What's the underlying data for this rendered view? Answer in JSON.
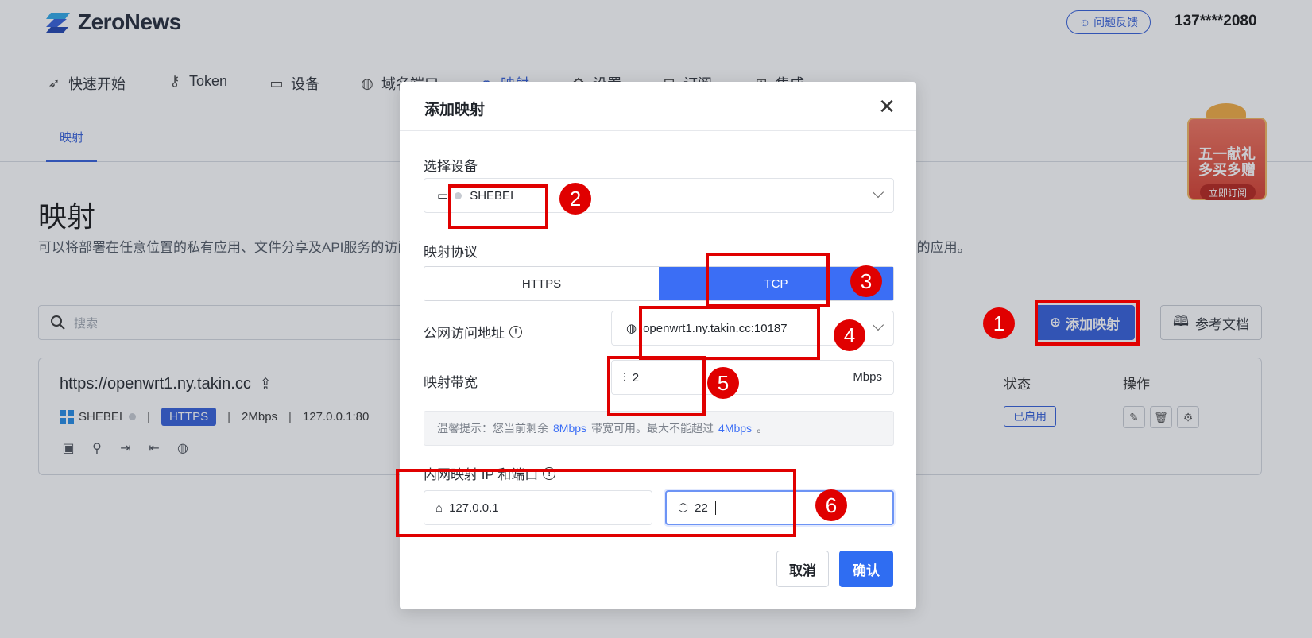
{
  "app": {
    "logo_text": "ZeroNews",
    "feedback_label": "问题反馈",
    "user_phone": "137****2080"
  },
  "nav": [
    {
      "label": "快速开始",
      "icon": "rocket-icon"
    },
    {
      "label": "Token",
      "icon": "key-icon"
    },
    {
      "label": "设备",
      "icon": "laptop-icon"
    },
    {
      "label": "域名端口",
      "icon": "globe-icon"
    },
    {
      "label": "映射",
      "icon": "mapping-icon",
      "active": true
    },
    {
      "label": "设置",
      "icon": "gear-icon"
    },
    {
      "label": "订阅",
      "icon": "ticket-icon"
    },
    {
      "label": "集成",
      "icon": "integration-icon"
    }
  ],
  "subnav": {
    "tab": "映射"
  },
  "promo": {
    "line1": "五一献礼",
    "line2": "多买多赠",
    "button": "立即订阅"
  },
  "page": {
    "title": "映射",
    "description": "可以将部署在任意位置的私有应用、文件分享及API服务的访问地址，映射到公网，实现安全高效的公网访问。支持 HTTP、HTTPS及TCP 协议类型的应用。",
    "search_placeholder": "搜索",
    "add_button": "添加映射",
    "docs_button": "参考文档"
  },
  "mapping_card": {
    "url": "https://openwrt1.ny.takin.cc",
    "device": "SHEBEI",
    "protocol": "HTTPS",
    "bandwidth": "2Mbps",
    "local": "127.0.0.1:80",
    "status_header": "状态",
    "ops_header": "操作",
    "status": "已启用"
  },
  "modal": {
    "title": "添加映射",
    "device_label": "选择设备",
    "device_value": "SHEBEI",
    "protocol_label": "映射协议",
    "protocol_options": [
      "HTTPS",
      "TCP"
    ],
    "protocol_selected": "TCP",
    "public_label": "公网访问地址",
    "public_value": "openwrt1.ny.takin.cc:10187",
    "bandwidth_label": "映射带宽",
    "bandwidth_value": "2",
    "bandwidth_unit": "Mbps",
    "hint_prefix": "温馨提示：您当前剩余",
    "hint_remaining": "8Mbps",
    "hint_middle": "带宽可用。最大不能超过",
    "hint_max": "4Mbps",
    "hint_suffix": "。",
    "local_label": "内网映射 IP 和端口",
    "local_ip": "127.0.0.1",
    "local_port": "22",
    "cancel": "取消",
    "confirm": "确认"
  },
  "annotations": [
    "1",
    "2",
    "3",
    "4",
    "5",
    "6"
  ],
  "colors": {
    "accent": "#2f5bd9",
    "annotation": "#e00000",
    "selected": "#3b6ef5"
  }
}
